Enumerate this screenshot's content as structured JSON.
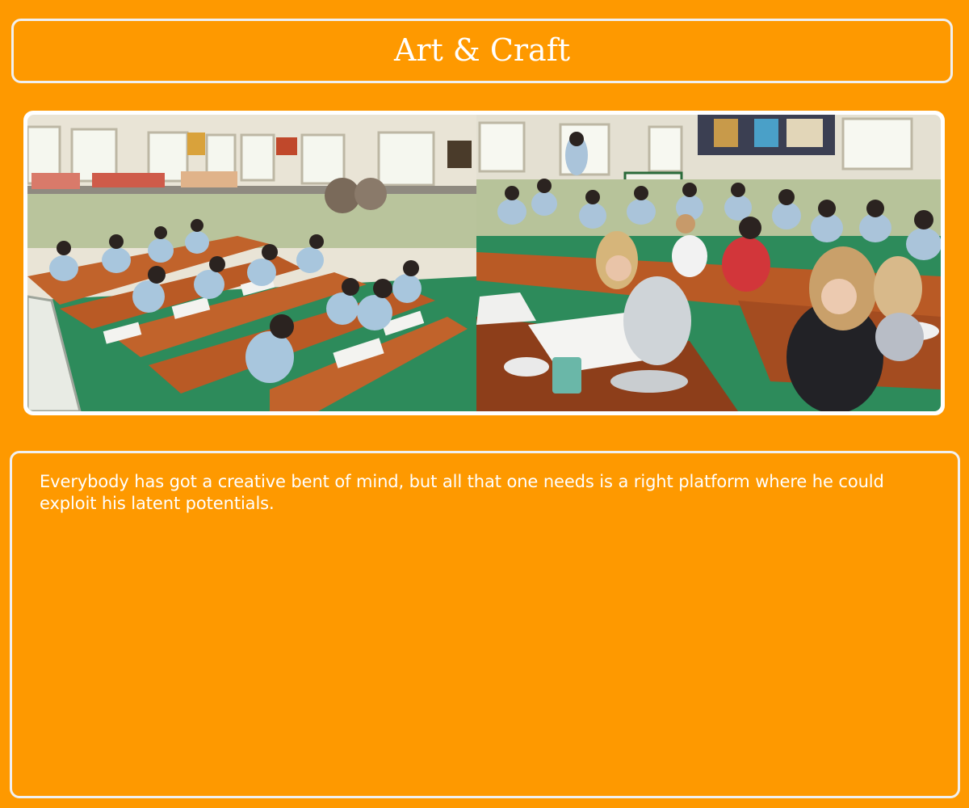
{
  "page": {
    "title": "Art & Craft",
    "description": "Everybody has got a creative bent of mind, but all that one needs is a right platform where he could exploit his latent potentials."
  },
  "photo": {
    "left_scene": "students-drawing-at-desks",
    "right_scene": "students-painting-with-visitors"
  },
  "colors": {
    "background": "#fe9900",
    "border": "#f0f0f0",
    "text": "#ffffff"
  }
}
